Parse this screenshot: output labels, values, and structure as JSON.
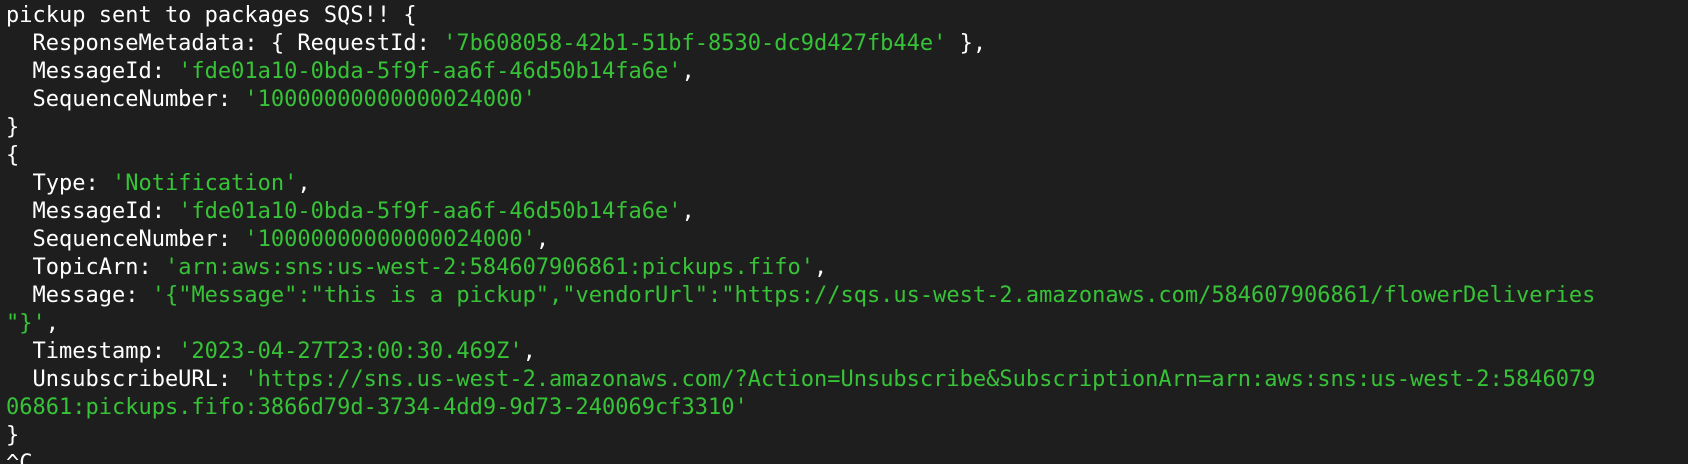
{
  "colors": {
    "background": "#1e1e1e",
    "text": "#ffffff",
    "string": "#37c337"
  },
  "lines": [
    [
      {
        "t": "pickup sent to packages SQS!! {",
        "c": "w"
      }
    ],
    [
      {
        "t": "  ResponseMetadata: { RequestId: ",
        "c": "w"
      },
      {
        "t": "'7b608058-42b1-51bf-8530-dc9d427fb44e'",
        "c": "s"
      },
      {
        "t": " },",
        "c": "w"
      }
    ],
    [
      {
        "t": "  MessageId: ",
        "c": "w"
      },
      {
        "t": "'fde01a10-0bda-5f9f-aa6f-46d50b14fa6e'",
        "c": "s"
      },
      {
        "t": ",",
        "c": "w"
      }
    ],
    [
      {
        "t": "  SequenceNumber: ",
        "c": "w"
      },
      {
        "t": "'10000000000000024000'",
        "c": "s"
      }
    ],
    [
      {
        "t": "}",
        "c": "w"
      }
    ],
    [
      {
        "t": "{",
        "c": "w"
      }
    ],
    [
      {
        "t": "  Type: ",
        "c": "w"
      },
      {
        "t": "'Notification'",
        "c": "s"
      },
      {
        "t": ",",
        "c": "w"
      }
    ],
    [
      {
        "t": "  MessageId: ",
        "c": "w"
      },
      {
        "t": "'fde01a10-0bda-5f9f-aa6f-46d50b14fa6e'",
        "c": "s"
      },
      {
        "t": ",",
        "c": "w"
      }
    ],
    [
      {
        "t": "  SequenceNumber: ",
        "c": "w"
      },
      {
        "t": "'10000000000000024000'",
        "c": "s"
      },
      {
        "t": ",",
        "c": "w"
      }
    ],
    [
      {
        "t": "  TopicArn: ",
        "c": "w"
      },
      {
        "t": "'arn:aws:sns:us-west-2:584607906861:pickups.fifo'",
        "c": "s"
      },
      {
        "t": ",",
        "c": "w"
      }
    ],
    [
      {
        "t": "  Message: ",
        "c": "w"
      },
      {
        "t": "'{\"Message\":\"this is a pickup\",\"vendorUrl\":\"https://sqs.us-west-2.amazonaws.com/584607906861/flowerDeliveries",
        "c": "s"
      }
    ],
    [
      {
        "t": "\"}'",
        "c": "s"
      },
      {
        "t": ",",
        "c": "w"
      }
    ],
    [
      {
        "t": "  Timestamp: ",
        "c": "w"
      },
      {
        "t": "'2023-04-27T23:00:30.469Z'",
        "c": "s"
      },
      {
        "t": ",",
        "c": "w"
      }
    ],
    [
      {
        "t": "  UnsubscribeURL: ",
        "c": "w"
      },
      {
        "t": "'https://sns.us-west-2.amazonaws.com/?Action=Unsubscribe&SubscriptionArn=arn:aws:sns:us-west-2:5846079",
        "c": "s"
      }
    ],
    [
      {
        "t": "06861:pickups.fifo:3866d79d-3734-4dd9-9d73-240069cf3310'",
        "c": "s"
      }
    ],
    [
      {
        "t": "}",
        "c": "w"
      }
    ],
    [
      {
        "t": "^C",
        "c": "w"
      }
    ]
  ]
}
